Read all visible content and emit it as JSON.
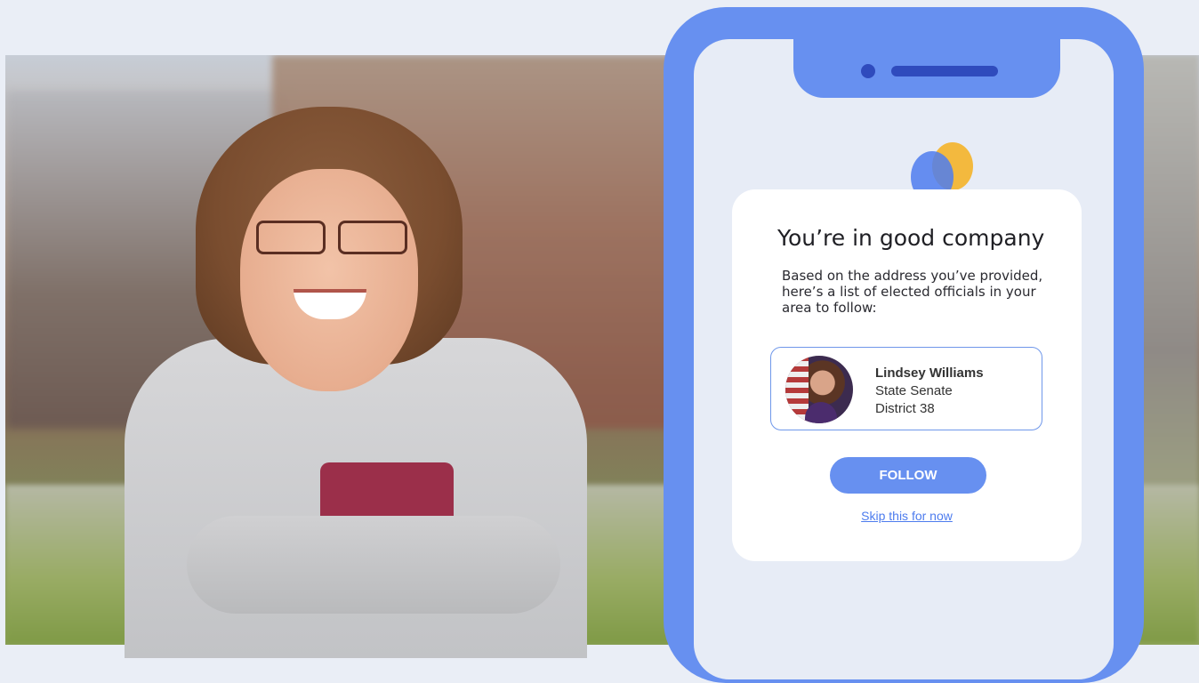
{
  "card": {
    "title": "You’re in good company",
    "description": "Based on the address you’ve provided, here’s a list of elected officials in your area to follow:",
    "official": {
      "name": "Lindsey Williams",
      "line1": "State Senate",
      "line2": "District 38"
    },
    "follow_label": "FOLLOW",
    "skip_label": "Skip this for now"
  },
  "colors": {
    "phone_frame": "#6790f0",
    "screen_bg": "#e7ecf6",
    "accent": "#4d7cee",
    "logo_yellow": "#f3b93e"
  },
  "icons": [
    "app-logo-icon",
    "camera-icon",
    "speaker-icon"
  ]
}
